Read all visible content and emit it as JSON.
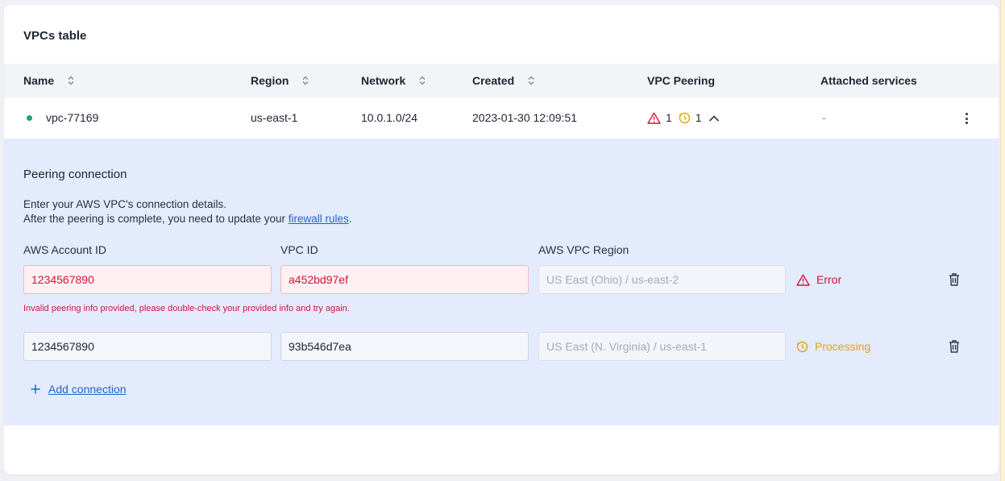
{
  "card": {
    "title": "VPCs table"
  },
  "table": {
    "columns": [
      "Name",
      "Region",
      "Network",
      "Created",
      "VPC Peering",
      "Attached services"
    ],
    "row": {
      "name": "vpc-77169",
      "region": "us-east-1",
      "network": "10.0.1.0/24",
      "created": "2023-01-30 12:09:51",
      "peering_error_count": "1",
      "peering_processing_count": "1",
      "attached_services": "-",
      "status_color": "#1ea672"
    }
  },
  "peering": {
    "title": "Peering connection",
    "desc_line1": "Enter your AWS VPC's connection details.",
    "desc_line2_prefix": "After the peering is complete, you need to update your ",
    "desc_link": "firewall rules",
    "desc_line2_suffix": ".",
    "labels": {
      "account_id": "AWS Account ID",
      "vpc_id": "VPC ID",
      "region": "AWS VPC Region"
    },
    "connections": [
      {
        "account_id": "1234567890",
        "vpc_id": "a452bd97ef",
        "region": "US East (Ohio) / us-east-2",
        "status": "Error"
      },
      {
        "account_id": "1234567890",
        "vpc_id": "93b546d7ea",
        "region": "US East (N. Virginia) / us-east-1",
        "status": "Processing"
      }
    ],
    "error_message": "Invalid peering info provided, please double-check your provided info and try again.",
    "add_connection": "Add connection"
  },
  "colors": {
    "error": "#d4143a",
    "processing": "#e0a614",
    "link": "#1e64d6",
    "panel_bg": "#e3ebfc"
  },
  "icons": [
    "sort-icon",
    "warning-icon",
    "clock-icon",
    "chevron-up-icon",
    "kebab-menu-icon",
    "trash-icon",
    "plus-icon"
  ]
}
